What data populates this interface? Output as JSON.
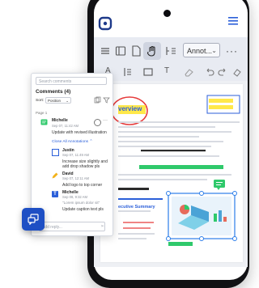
{
  "toolbar": {
    "annotation_dropdown": "Annot...",
    "more": "···"
  },
  "comments": {
    "search_placeholder": "Search comments",
    "title": "Comments (4)",
    "sort_label": "Sort:",
    "sort_value": "Position",
    "page_label": "Page 1",
    "thread": {
      "author": "Michelle",
      "timestamp": "Sep 07, 11:42 AM",
      "text": "Update with revised illustration",
      "close_all": "Close All Annotations"
    },
    "replies": [
      {
        "author": "Justin",
        "timestamp": "Sep 07, 11:49 AM",
        "text": [
          "Increase size slightly and",
          "add drop shadow pls"
        ]
      },
      {
        "author": "David",
        "timestamp": "Sep 07, 12:11 AM",
        "text": [
          "Add logo to top corner"
        ]
      },
      {
        "author": "Michelle",
        "timestamp": "Sep 08, 9:32 AM",
        "quote": "\"Lorem ipsum dolor sit\"",
        "text": [
          "Update caption text pls"
        ]
      }
    ],
    "reply_placeholder": "Add reply..."
  },
  "document": {
    "heading1": "verview",
    "heading2": "ecutive Summary"
  },
  "colors": {
    "accent": "#2b5fd9",
    "highlight_yellow": "#ffe84a",
    "green_bar": "#2fc96b",
    "ink_red": "#e63a3a",
    "blue_box": "#2b7de9"
  }
}
